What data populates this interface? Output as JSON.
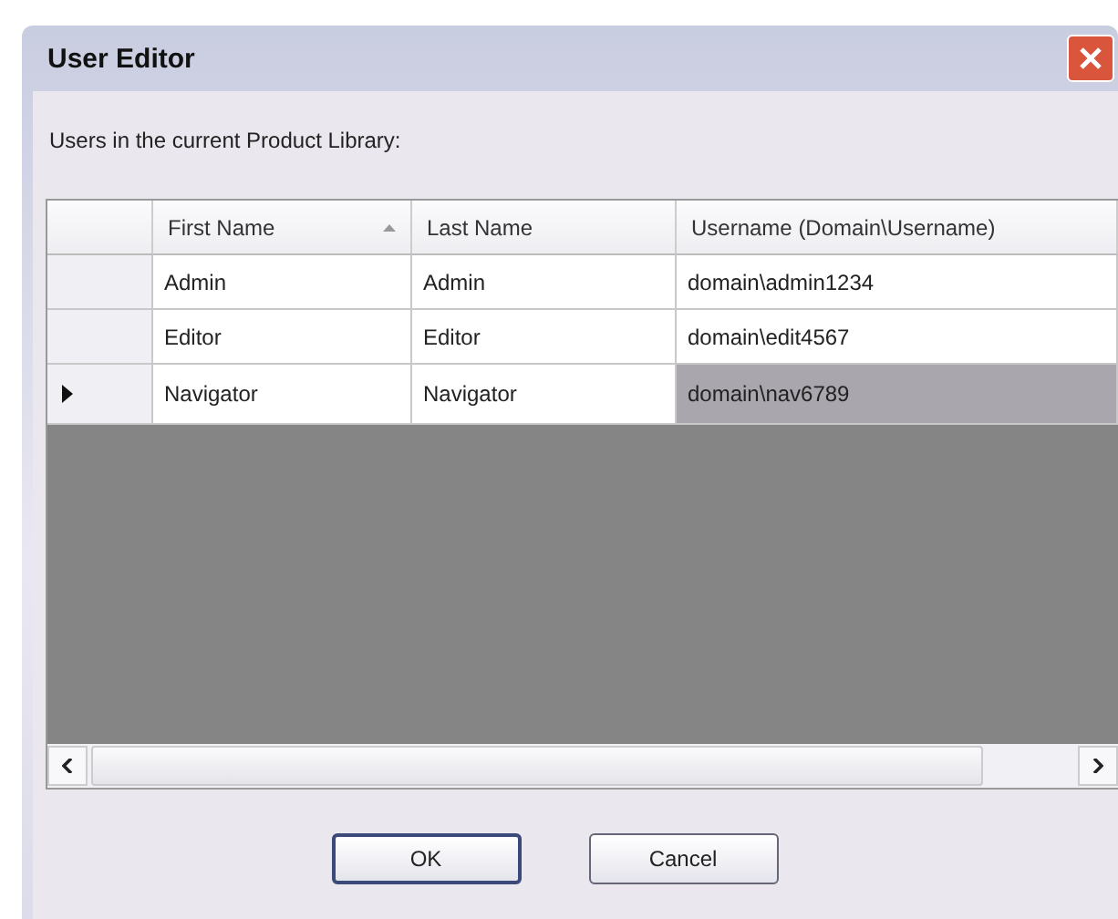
{
  "window": {
    "title": "User Editor"
  },
  "caption": "Users in the current Product Library:",
  "table": {
    "columns": [
      {
        "label": "First Name",
        "sorted": true
      },
      {
        "label": "Last Name",
        "sorted": false
      },
      {
        "label": "Username (Domain\\Username)",
        "sorted": false
      }
    ],
    "rows": [
      {
        "cells": [
          "Admin",
          "Admin",
          "domain\\admin1234"
        ],
        "selected": false
      },
      {
        "cells": [
          "Editor",
          "Editor",
          "domain\\edit4567"
        ],
        "selected": false
      },
      {
        "cells": [
          "Navigator",
          "Navigator",
          "domain\\nav6789"
        ],
        "selected": true
      }
    ]
  },
  "buttons": [
    {
      "label": "OK",
      "default": true
    },
    {
      "label": "Cancel",
      "default": false
    }
  ]
}
